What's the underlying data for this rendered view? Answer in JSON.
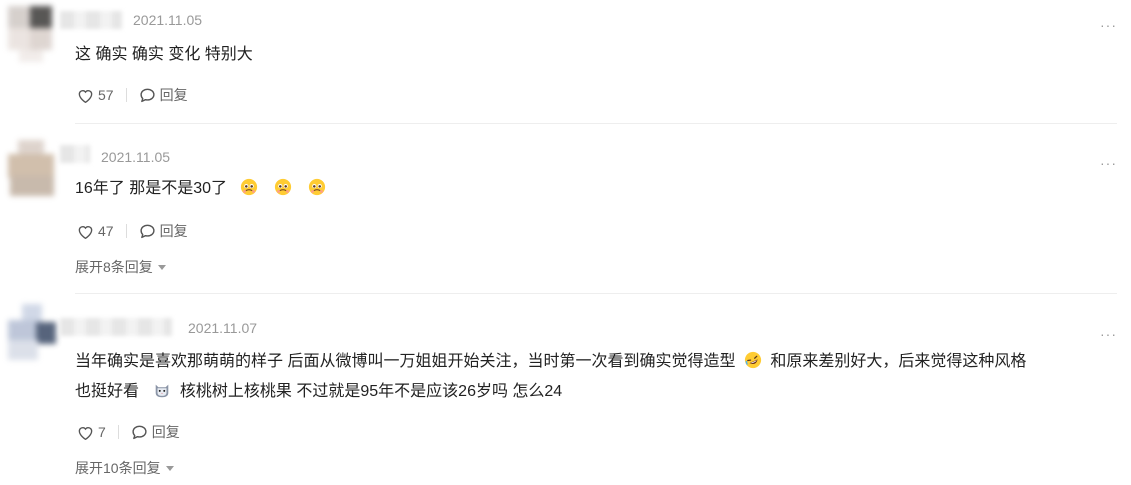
{
  "comments": [
    {
      "time": "2021.11.05",
      "text": "这 确实 确实 变化 特别大",
      "likes": "57",
      "reply_label": "回复"
    },
    {
      "time": "2021.11.05",
      "text": "16年了 那是不是30了",
      "likes": "47",
      "reply_label": "回复",
      "expand_label": "展开8条回复"
    },
    {
      "time": "2021.11.07",
      "text_line1": "当年确实是喜欢那萌萌的样子 后面从微博叫一万姐姐开始关注，当时第一次看到确实觉得造型",
      "text_line1_after": "和原来差别好大，后来觉得这种风格",
      "text_line2_a": "也挺好看",
      "text_line2_b": "核桃树上核桃果 不过就是95年不是应该26岁吗 怎么24",
      "likes": "7",
      "reply_label": "回复",
      "expand_label": "展开10条回复"
    }
  ],
  "more_glyph": "···",
  "icons": {
    "like": "heart-outline-icon",
    "reply": "speech-bubble-icon",
    "pleading": "pleading-face-emoji",
    "laughing": "rolling-laughing-emoji",
    "cat": "cat-face-emoji"
  }
}
